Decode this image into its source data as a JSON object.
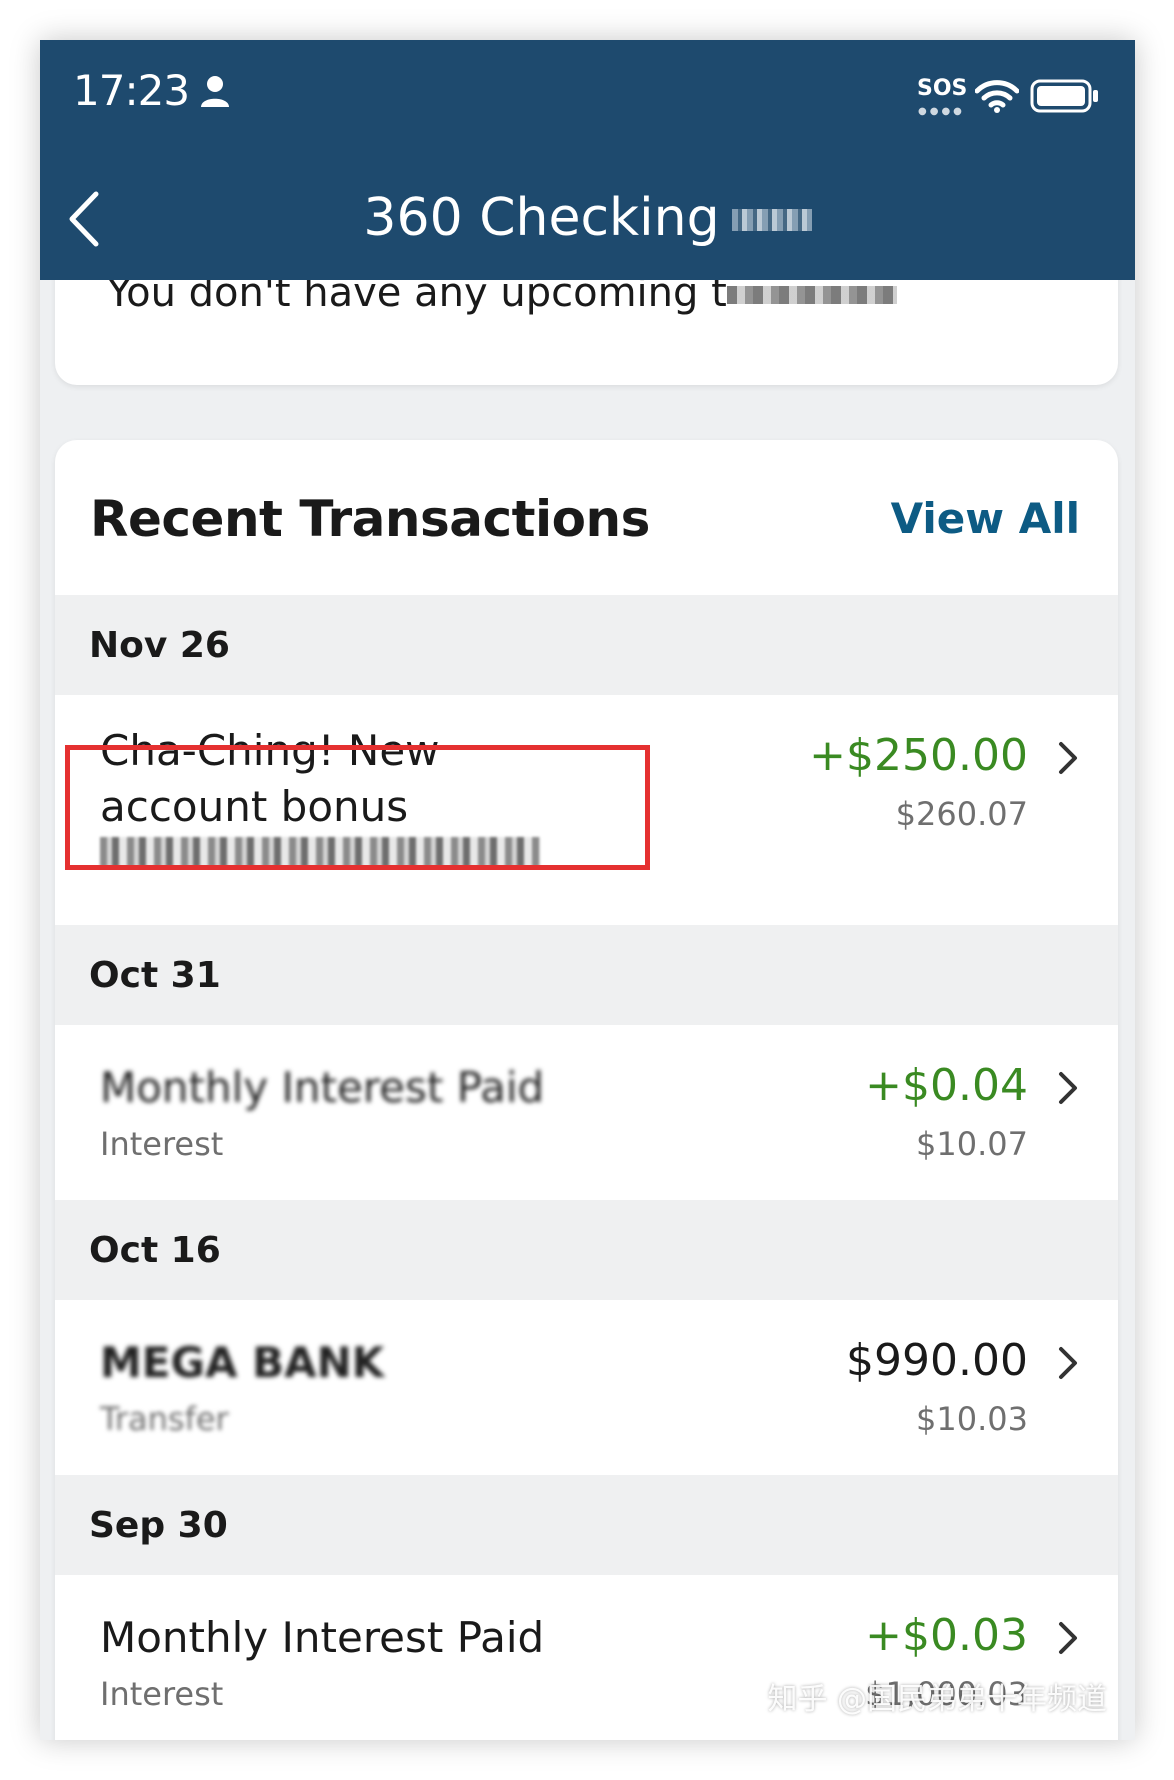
{
  "status_bar": {
    "time": "17:23",
    "sos": "SOS",
    "icons": [
      "person-icon",
      "wifi-icon",
      "battery-icon"
    ]
  },
  "header": {
    "title": "360 Checking",
    "back_icon": "chevron-left-icon"
  },
  "upcoming": {
    "message": "You don't have any upcoming t"
  },
  "transactions": {
    "title": "Recent Transactions",
    "view_all_label": "View All",
    "groups": [
      {
        "date": "Nov 26",
        "items": [
          {
            "name": "Cha-Ching! New account bonus",
            "amount": "+$250.00",
            "balance": "$260.07"
          }
        ]
      },
      {
        "date": "Oct 31",
        "items": [
          {
            "name": "Monthly Interest Paid",
            "subtitle": "Interest",
            "amount": "+$0.04",
            "balance": "$10.07"
          }
        ]
      },
      {
        "date": "Oct 16",
        "items": [
          {
            "name": "MEGA BANK",
            "subtitle": "Transfer",
            "amount": "$990.00",
            "balance": "$10.03"
          }
        ]
      },
      {
        "date": "Sep 30",
        "items": [
          {
            "name": "Monthly Interest Paid",
            "subtitle": "Interest",
            "amount": "+$0.03",
            "balance": "$1,000.03"
          }
        ]
      }
    ]
  },
  "colors": {
    "header_bg": "#1e4a6e",
    "credit_green": "#3a8a22",
    "link_blue": "#0d5b84",
    "highlight_red": "#e53030",
    "section_gray": "#eff0f1"
  },
  "watermark": "知乎 @国民弟弟十年频道"
}
